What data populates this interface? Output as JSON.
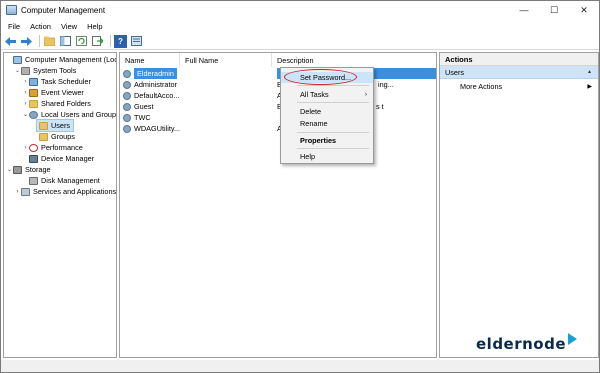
{
  "window": {
    "title": "Computer Management",
    "minimize": "—",
    "maximize": "☐",
    "close": "✕"
  },
  "menu": [
    "File",
    "Action",
    "View",
    "Help"
  ],
  "toolbar": {
    "icons": [
      "back-arrow-icon",
      "forward-arrow-icon",
      "folder-up-icon",
      "show-hide-tree-icon",
      "refresh-icon",
      "export-list-icon",
      "help-icon",
      "properties-icon"
    ],
    "help_glyph": "?"
  },
  "tree": {
    "items": [
      {
        "label": "Computer Management (Local",
        "expander": ""
      },
      {
        "label": "System Tools",
        "expander": "⌄"
      },
      {
        "label": "Task Scheduler",
        "expander": "›"
      },
      {
        "label": "Event Viewer",
        "expander": "›"
      },
      {
        "label": "Shared Folders",
        "expander": "›"
      },
      {
        "label": "Local Users and Groups",
        "expander": "⌄"
      },
      {
        "label": "Users",
        "expander": ""
      },
      {
        "label": "Groups",
        "expander": ""
      },
      {
        "label": "Performance",
        "expander": "›"
      },
      {
        "label": "Device Manager",
        "expander": ""
      },
      {
        "label": "Storage",
        "expander": "⌄"
      },
      {
        "label": "Disk Management",
        "expander": ""
      },
      {
        "label": "Services and Applications",
        "expander": "›"
      }
    ]
  },
  "list": {
    "columns": [
      "Name",
      "Full Name",
      "Description"
    ],
    "rows": [
      {
        "name": "Elderadmin",
        "desc": ""
      },
      {
        "name": "Administrator",
        "desc": "B"
      },
      {
        "name": "DefaultAcco...",
        "desc": "A"
      },
      {
        "name": "Guest",
        "desc": "B"
      },
      {
        "name": "TWC",
        "desc": ""
      },
      {
        "name": "WDAGUtility...",
        "desc": "A"
      }
    ],
    "desc_overflow": [
      "ing...",
      "s t"
    ]
  },
  "context_menu": {
    "set_password": "Set Password...",
    "all_tasks": "All Tasks",
    "delete": "Delete",
    "rename": "Rename",
    "properties": "Properties",
    "help": "Help",
    "submenu_arrow": "›"
  },
  "actions": {
    "header": "Actions",
    "section": "Users",
    "section_arrow": "▲",
    "more_actions": "More Actions",
    "more_arrow": "▶"
  },
  "watermark": {
    "text": "eldernode"
  },
  "colors": {
    "selection": "#3b8fde",
    "highlight": "#cce4f7",
    "ellipse": "#d02020",
    "brand": "#18a0d8"
  }
}
